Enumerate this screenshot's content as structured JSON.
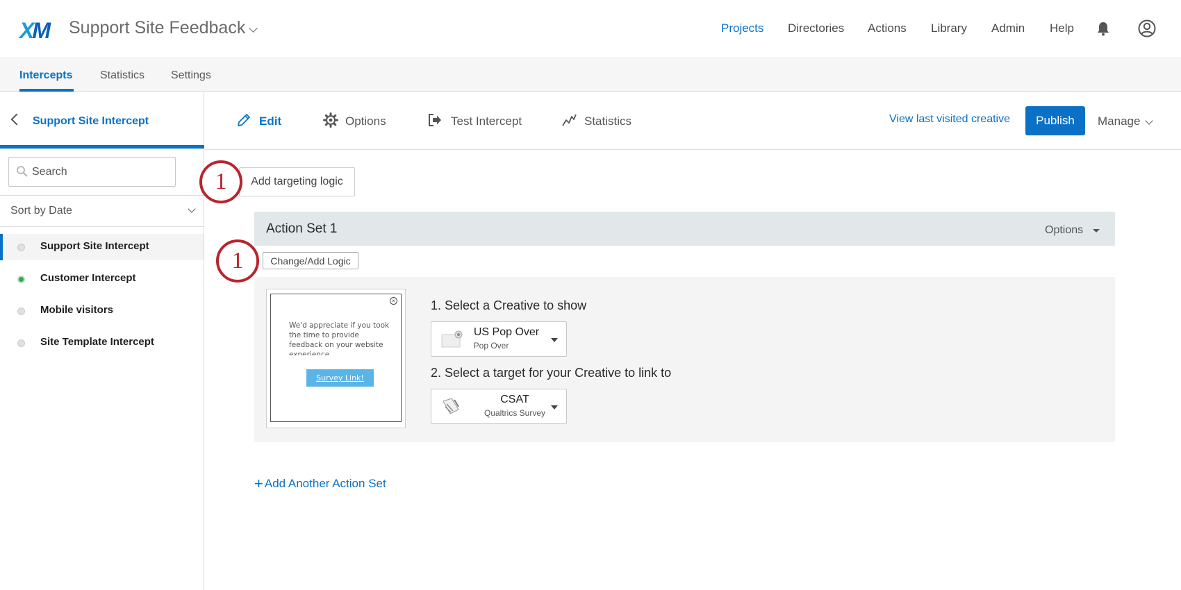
{
  "header": {
    "logo": "XM",
    "project_title": "Support Site Feedback",
    "nav": [
      "Projects",
      "Directories",
      "Actions",
      "Library",
      "Admin",
      "Help"
    ],
    "active_nav": "Projects"
  },
  "subtabs": {
    "items": [
      "Intercepts",
      "Statistics",
      "Settings"
    ],
    "active": "Intercepts"
  },
  "sidebar": {
    "title": "Support Site Intercept",
    "search_placeholder": "Search",
    "sort_label": "Sort by Date",
    "items": [
      {
        "label": "Support Site Intercept",
        "status": "inactive",
        "selected": true
      },
      {
        "label": "Customer Intercept",
        "status": "active",
        "selected": false
      },
      {
        "label": "Mobile visitors",
        "status": "inactive",
        "selected": false
      },
      {
        "label": "Site Template Intercept",
        "status": "inactive",
        "selected": false
      }
    ]
  },
  "toolbar": {
    "edit": "Edit",
    "options": "Options",
    "test": "Test Intercept",
    "statistics": "Statistics",
    "view_last": "View last visited creative",
    "publish": "Publish",
    "manage": "Manage"
  },
  "canvas": {
    "badge_1": "1",
    "badge_2": "1",
    "add_targeting": "Add targeting logic",
    "action_set_title": "Action Set 1",
    "action_set_options": "Options",
    "change_logic": "Change/Add Logic",
    "preview_text": "We'd appreciate if you took the time to provide feedback on your website experience.",
    "preview_link": "Survey Link!",
    "step1_label": "1. Select a Creative to show",
    "creative_name": "US Pop Over",
    "creative_type": "Pop Over",
    "step2_label": "2. Select a target for your Creative to link to",
    "target_name": "CSAT",
    "target_type": "Qualtrics Survey",
    "add_another": "Add Another Action Set"
  },
  "colors": {
    "accent": "#0b71c6",
    "badge": "#b8252f",
    "action_set_header": "#e2e8ea",
    "status_active": "#3aa35a"
  }
}
